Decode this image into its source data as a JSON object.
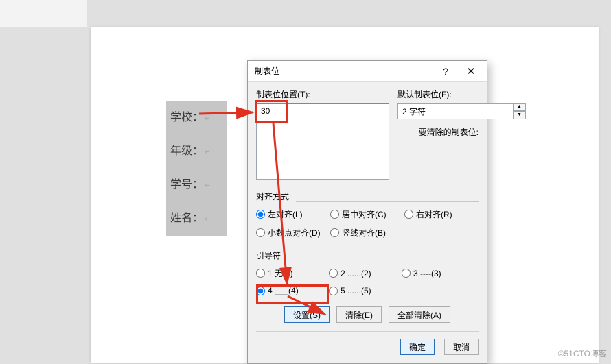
{
  "doc_labels": [
    "学校：",
    "年级：",
    "学号：",
    "姓名："
  ],
  "dialog": {
    "title": "制表位",
    "tab_position_label": "制表位位置(T):",
    "tab_position_value": "30",
    "default_tab_label": "默认制表位(F):",
    "default_tab_value": "2 字符",
    "clear_pending_label": "要清除的制表位:",
    "align": {
      "heading": "对齐方式",
      "left": "左对齐(L)",
      "center": "居中对齐(C)",
      "right": "右对齐(R)",
      "decimal": "小数点对齐(D)",
      "bar": "竖线对齐(B)"
    },
    "leader": {
      "heading": "引导符",
      "opt1": "1 无(1)",
      "opt2": "2 ......(2)",
      "opt3": "3 ----(3)",
      "opt4": "4 ___(4)",
      "opt5": "5 ......(5)"
    },
    "buttons": {
      "set": "设置(S)",
      "clear": "清除(E)",
      "clear_all": "全部清除(A)",
      "ok": "确定",
      "cancel": "取消"
    }
  },
  "watermark": "©51CTO博客"
}
